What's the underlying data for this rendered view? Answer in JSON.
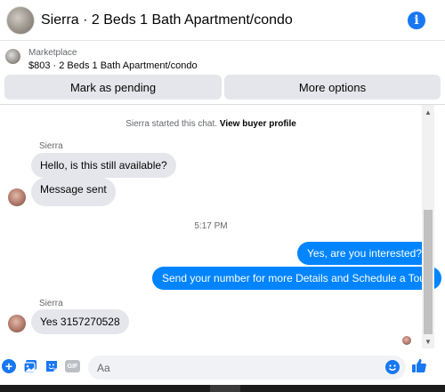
{
  "header": {
    "title": "Sierra · 2 Beds 1 Bath Apartment/condo",
    "info_icon": "info-icon"
  },
  "marketplace": {
    "label": "Marketplace",
    "listing": "$803 · 2 Beds 1 Bath Apartment/condo"
  },
  "actions": {
    "pending_label": "Mark as pending",
    "more_label": "More options"
  },
  "chat": {
    "system_prefix": "Sierra started this chat.",
    "system_link": "View buyer profile",
    "time": "5:17 PM",
    "messages": [
      {
        "sender": "Sierra",
        "text": "Hello, is this still available?",
        "direction": "in"
      },
      {
        "text": "Message sent",
        "direction": "in"
      },
      {
        "text": "Yes, are you interested?",
        "direction": "out"
      },
      {
        "text": "Send your number for more Details and Schedule a Tour.",
        "direction": "out"
      },
      {
        "sender": "Sierra",
        "text": "Yes 3157270528",
        "direction": "in"
      }
    ]
  },
  "composer": {
    "placeholder": "Aa",
    "gif_label": "GIF"
  },
  "colors": {
    "accent": "#1877f2",
    "outgoing_bubble": "#0084ff",
    "incoming_bubble": "#e4e6eb"
  }
}
